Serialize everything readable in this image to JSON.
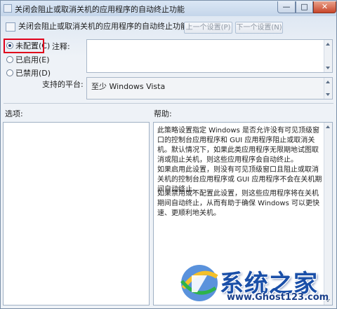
{
  "window": {
    "title": "关闭会阻止或取消关机的应用程序的自动终止功能",
    "minimize_label": "—",
    "maximize_label": "□",
    "close_label": "✕"
  },
  "header": {
    "policy_title": "关闭会阻止或取消关机的应用程序的自动终止功能",
    "prev_button": "上一个设置(P)",
    "next_button": "下一个设置(N)"
  },
  "state_options": [
    {
      "label": "未配置(C)",
      "checked": true
    },
    {
      "label": "已启用(E)",
      "checked": false
    },
    {
      "label": "已禁用(D)",
      "checked": false
    }
  ],
  "comment_label": "注释:",
  "platform_label": "支持的平台:",
  "platform_value": "至少 Windows Vista",
  "options_label": "选项:",
  "help_label": "帮助:",
  "help_paragraphs": [
    "此策略设置指定 Windows 是否允许没有可见顶级窗口的控制台应用程序和 GUI 应用程序阻止或取消关机。默认情况下，如果此类应用程序无限期地试图取消或阻止关机，则这些应用程序会自动终止。",
    "如果启用此设置，则没有可见顶级窗口且阻止或取消关机的控制台应用程序或 GUI 应用程序不会在关机期间自动终止。",
    "如果禁用或不配置此设置，则这些应用程序将在关机期间自动终止，从而有助于确保 Windows 可以更快速、更顺利地关机。"
  ],
  "watermark": {
    "title": "系统之家",
    "url": "www.Ghost123.com"
  },
  "colors": {
    "selection_outline": "#e0001b",
    "watermark_blue": "#1a4fa8"
  }
}
